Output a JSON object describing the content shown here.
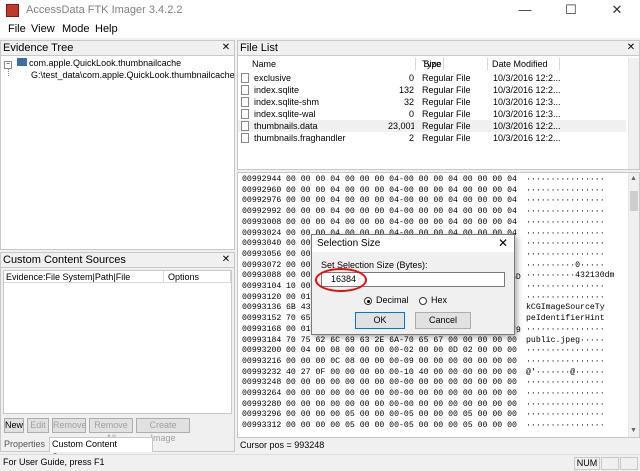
{
  "window": {
    "title": "AccessData FTK Imager 3.4.2.2",
    "minimize": "—",
    "maximize": "☐",
    "close": "✕"
  },
  "menu": [
    "File",
    "View",
    "Mode",
    "Help"
  ],
  "evidence_tree": {
    "title": "Evidence Tree",
    "root": "com.apple.QuickLook.thumbnailcache",
    "child": "G:\\test_data\\com.apple.QuickLook.thumbnailcache"
  },
  "custom_content": {
    "title": "Custom Content Sources",
    "col_evidence": "Evidence:File System|Path|File",
    "col_options": "Options",
    "buttons": [
      "New",
      "Edit",
      "Remove",
      "Remove All",
      "Create Image"
    ],
    "tabs": [
      "Properties",
      "Custom Content Sources"
    ]
  },
  "file_list": {
    "title": "File List",
    "columns": [
      "Name",
      "Size",
      "Type",
      "Date Modified"
    ],
    "rows": [
      {
        "name": "exclusive",
        "size": "0",
        "type": "Regular File",
        "date": "10/3/2016 12:2..."
      },
      {
        "name": "index.sqlite",
        "size": "132",
        "type": "Regular File",
        "date": "10/3/2016 12:2..."
      },
      {
        "name": "index.sqlite-shm",
        "size": "32",
        "type": "Regular File",
        "date": "10/3/2016 12:3..."
      },
      {
        "name": "index.sqlite-wal",
        "size": "0",
        "type": "Regular File",
        "date": "10/3/2016 12:3..."
      },
      {
        "name": "thumbnails.data",
        "size": "23,001",
        "type": "Regular File",
        "date": "10/3/2016 12:2..."
      },
      {
        "name": "thumbnails.fraghandler",
        "size": "2",
        "type": "Regular File",
        "date": "10/3/2016 12:2..."
      }
    ],
    "selected_index": 4
  },
  "hex_view": {
    "offsets": [
      "00992944",
      "00992960",
      "00992976",
      "00992992",
      "00993008",
      "00993024",
      "00993040",
      "00993056",
      "00993072",
      "00993088",
      "00993104",
      "00993120",
      "00993136",
      "00993152",
      "00993168",
      "00993184",
      "00993200",
      "00993216",
      "00993232",
      "00993248",
      "00993264",
      "00993280",
      "00993296",
      "00993312"
    ],
    "hex": [
      "00 00 00 04 00 00 00 04-00 00 00 04 00 00 00 04",
      "00 00 00 04 00 00 00 04-00 00 00 04 00 00 00 04",
      "00 00 00 04 00 00 00 04-00 00 00 04 00 00 00 04",
      "00 00 00 04 00 00 00 04-00 00 00 04 00 00 00 04",
      "00 00 00 04 00 00 00 04-00 00 00 04 00 00 00 04",
      "00 00 00 04 00 00 00 04-00 00 00 04 00 00 00 04",
      "00 00",
      "00 00",
      "00 00",
      "00 00",
      "10 00",
      "00 01",
      "6B 43",
      "70 65",
      "00 01",
      "70 75 62 6C 69 63 2E 6A-70 65 67 00 00 00 00 00",
      "00 04 00 08 00 00 00 00-02 00 00 0D 02 00 00 00",
      "00 00 00 0C 08 00 00 00-09 00 00 00 00 00 00 00",
      "40 27 0F 00 00 00 00 00-10 40 00 00 00 00 00 00",
      "00 00 00 00 00 00 00 00-00 00 00 00 00 00 00 00",
      "00 00 00 00 00 00 00 00-00 00 00 00 00 00 00 00",
      "00 00 00 00 00 00 00 00-00 00 00 00 00 00 00 00",
      "00 00 00 00 05 00 00 00-05 00 00 00 05 00 00 00",
      "00 00 00 00 05 00 00 00-05 00 00 00 05 00 00 00"
    ],
    "ascii": [
      "················",
      "················",
      "················",
      "················",
      "················",
      "················",
      "················",
      "················",
      "··········0·····",
      "··········432130dm",
      "················",
      "················",
      "kCGImageSourceTy",
      "peIdentifierHint",
      "················",
      "public.jpeg·····",
      "················",
      "················",
      "@'·······@······",
      "················",
      "················",
      "················",
      "················",
      "················"
    ],
    "tail_fragments": [
      "6D",
      "79"
    ],
    "cursor": "Cursor pos = 993248"
  },
  "dialog": {
    "title": "Selection Size",
    "label": "Set Selection Size (Bytes):",
    "value": "16384",
    "radio_decimal": "Decimal",
    "radio_hex": "Hex",
    "ok": "OK",
    "cancel": "Cancel"
  },
  "status": {
    "text": "For User Guide, press F1",
    "num": "NUM"
  },
  "colors": {
    "highlight_circle": "#e01010",
    "selection": "#cce8ff"
  }
}
